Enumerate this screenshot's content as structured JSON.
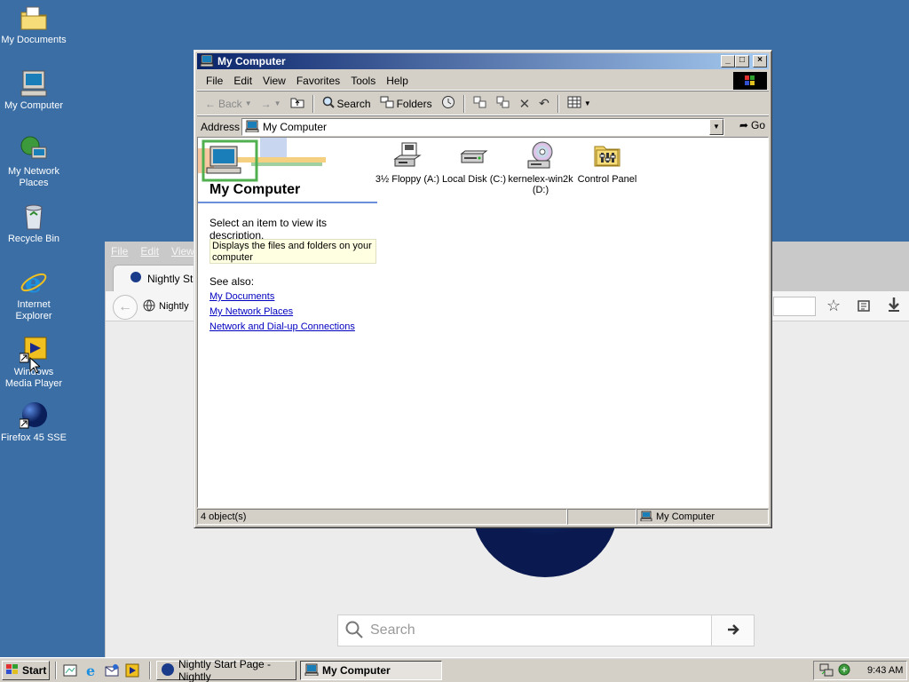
{
  "desktop": {
    "icons": [
      {
        "label": "My Documents",
        "icon": "folder-documents-icon"
      },
      {
        "label": "My Computer",
        "icon": "computer-icon"
      },
      {
        "label": "My Network Places",
        "icon": "network-icon"
      },
      {
        "label": "Recycle Bin",
        "icon": "recycle-bin-icon"
      },
      {
        "label": "Internet Explorer",
        "icon": "ie-icon"
      },
      {
        "label": "Windows Media Player",
        "icon": "media-player-icon"
      },
      {
        "label": "Firefox 45 SSE",
        "icon": "firefox-icon"
      }
    ]
  },
  "firefox": {
    "menu": [
      "File",
      "Edit",
      "View"
    ],
    "tab_label": "Nightly Sta",
    "url_text": "Nightly",
    "search_placeholder": "Search"
  },
  "mycomputer": {
    "title": "My Computer",
    "menu": [
      "File",
      "Edit",
      "View",
      "Favorites",
      "Tools",
      "Help"
    ],
    "toolbar": {
      "back": "Back",
      "search": "Search",
      "folders": "Folders"
    },
    "address_label": "Address",
    "address_value": "My Computer",
    "go_label": "Go",
    "pane_title": "My Computer",
    "pane_prompt": "Select an item to view its description.",
    "pane_desc": "Displays the files and folders on your computer",
    "see_also": "See also:",
    "links": [
      "My Documents",
      "My Network Places",
      "Network and Dial-up Connections"
    ],
    "items": [
      {
        "label": "3½ Floppy (A:)",
        "icon": "floppy-drive-icon"
      },
      {
        "label": "Local Disk (C:)",
        "icon": "hard-disk-icon"
      },
      {
        "label": "kernelex-win2k (D:)",
        "icon": "cd-drive-icon"
      },
      {
        "label": "Control Panel",
        "icon": "control-panel-icon"
      }
    ],
    "status_count": "4 object(s)",
    "status_zone": "My Computer"
  },
  "taskbar": {
    "start_label": "Start",
    "tasks": [
      "Nightly Start Page - Nightly",
      "My Computer"
    ],
    "clock": "9:43 AM"
  }
}
